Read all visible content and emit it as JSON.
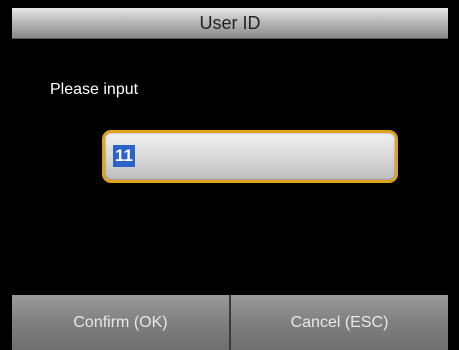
{
  "window": {
    "title": "User ID"
  },
  "form": {
    "prompt": "Please input",
    "input_value": "11"
  },
  "buttons": {
    "confirm_label": "Confirm (OK)",
    "cancel_label": "Cancel (ESC)"
  },
  "colors": {
    "input_border": "#e0a21c",
    "selection": "#2b63c9",
    "background": "#000000"
  }
}
